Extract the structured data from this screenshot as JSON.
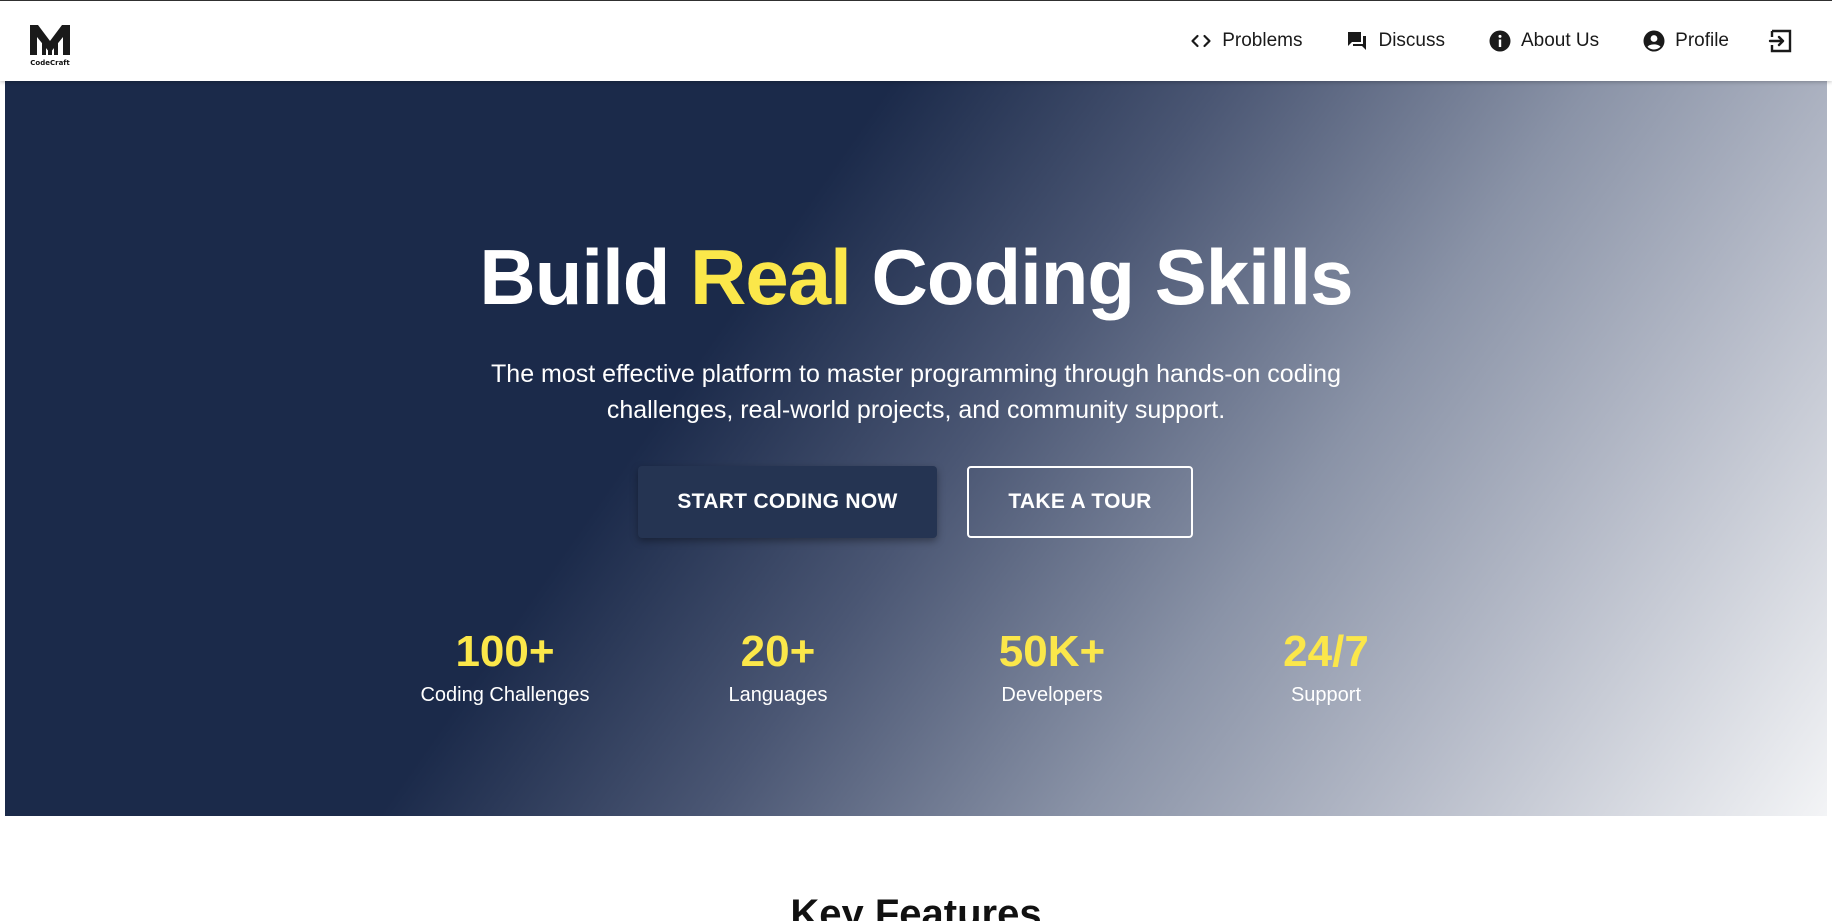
{
  "brand": {
    "logo_text": "CodeCraft",
    "logo_icon": "codecraft-logo"
  },
  "nav": {
    "items": [
      {
        "label": "Problems",
        "icon": "code-brackets-icon"
      },
      {
        "label": "Discuss",
        "icon": "chat-bubbles-icon"
      },
      {
        "label": "About Us",
        "icon": "info-icon"
      },
      {
        "label": "Profile",
        "icon": "account-circle-icon"
      }
    ],
    "logout_icon": "logout-icon"
  },
  "hero": {
    "title_before": "Build",
    "title_highlight": "Real",
    "title_after": "Coding Skills",
    "subtitle": "The most effective platform to master programming through hands-on coding challenges, real-world projects, and community support.",
    "primary_button": "START CODING NOW",
    "secondary_button": "TAKE A TOUR",
    "stats": [
      {
        "value": "100+",
        "label": "Coding Challenges"
      },
      {
        "value": "20+",
        "label": "Languages"
      },
      {
        "value": "50K+",
        "label": "Developers"
      },
      {
        "value": "24/7",
        "label": "Support"
      }
    ]
  },
  "features": {
    "title": "Key Features"
  },
  "colors": {
    "hero_dark": "#1b2a4a",
    "accent_yellow": "#fbe74a",
    "primary_button": "#253452",
    "text_white": "#ffffff"
  }
}
